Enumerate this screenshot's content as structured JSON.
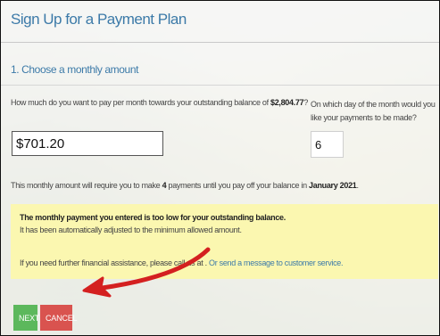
{
  "page": {
    "title": "Sign Up for a Payment Plan"
  },
  "step": {
    "label": "1. Choose a monthly amount"
  },
  "amount_question": {
    "prefix": "How much do you want to pay per month towards your outstanding balance of ",
    "balance": "$2,804.77",
    "suffix": "?"
  },
  "day_question": {
    "text": "On which day of the month would you like your payments to be made?"
  },
  "amount_input": {
    "value": "$701.20"
  },
  "day_input": {
    "value": "6"
  },
  "summary": {
    "prefix": "This monthly amount will require you to make ",
    "payments": "4",
    "middle": " payments until you pay off your balance in ",
    "date": "January 2021",
    "suffix": "."
  },
  "alert": {
    "title": "The monthly payment you entered is too low for your outstanding balance.",
    "subtitle": "It has been automatically adjusted to the minimum allowed amount.",
    "help_prefix": "If you need further financial assistance, please call us at . ",
    "help_link": "Or send a message to customer service."
  },
  "buttons": {
    "next": "NEXT",
    "cancel": "CANCEL"
  },
  "colors": {
    "heading": "#3c7aa8",
    "alert_background": "#fbf7b0",
    "next_button": "#5cb85c",
    "cancel_button": "#d9534f",
    "arrow": "#d42020"
  },
  "annotation": {
    "icon": "red-arrow-icon"
  }
}
